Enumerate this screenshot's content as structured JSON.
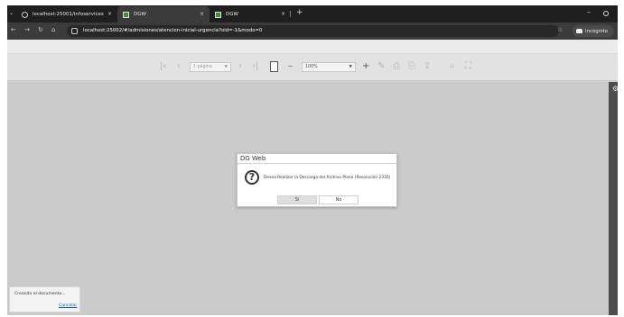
{
  "browser": {
    "tabs": [
      {
        "title": "localhost:25001/infoservices",
        "close": "×",
        "icon": "globe-icon"
      },
      {
        "title": "DGW",
        "close": "×",
        "icon": "app-icon"
      },
      {
        "title": "DGW",
        "close": "×",
        "icon": "app-icon"
      }
    ],
    "new_tab": "+",
    "url": "localhost:25002/#/admisiones/atencion-inicial-urgencia?oid=-1&modo=0",
    "incognito_label": "Incógnito",
    "window_minimize": "–"
  },
  "toolbar": {
    "page_select": "1 página",
    "zoom_select": "100%"
  },
  "dialog": {
    "title": "DG Web",
    "icon": "?",
    "message": "Desea Realizar la Descarga del Archivo Plano (Resolución 2335)",
    "yes_label": "Si",
    "no_label": "No"
  },
  "toast": {
    "text": "Creando el documento...",
    "cancel_label": "Cancelar"
  },
  "colors": {
    "tab_strip": "#1f1f1f",
    "address_bar": "#3b3b3b",
    "viewer_background": "#cbcbcb",
    "link": "#1a56c8"
  }
}
